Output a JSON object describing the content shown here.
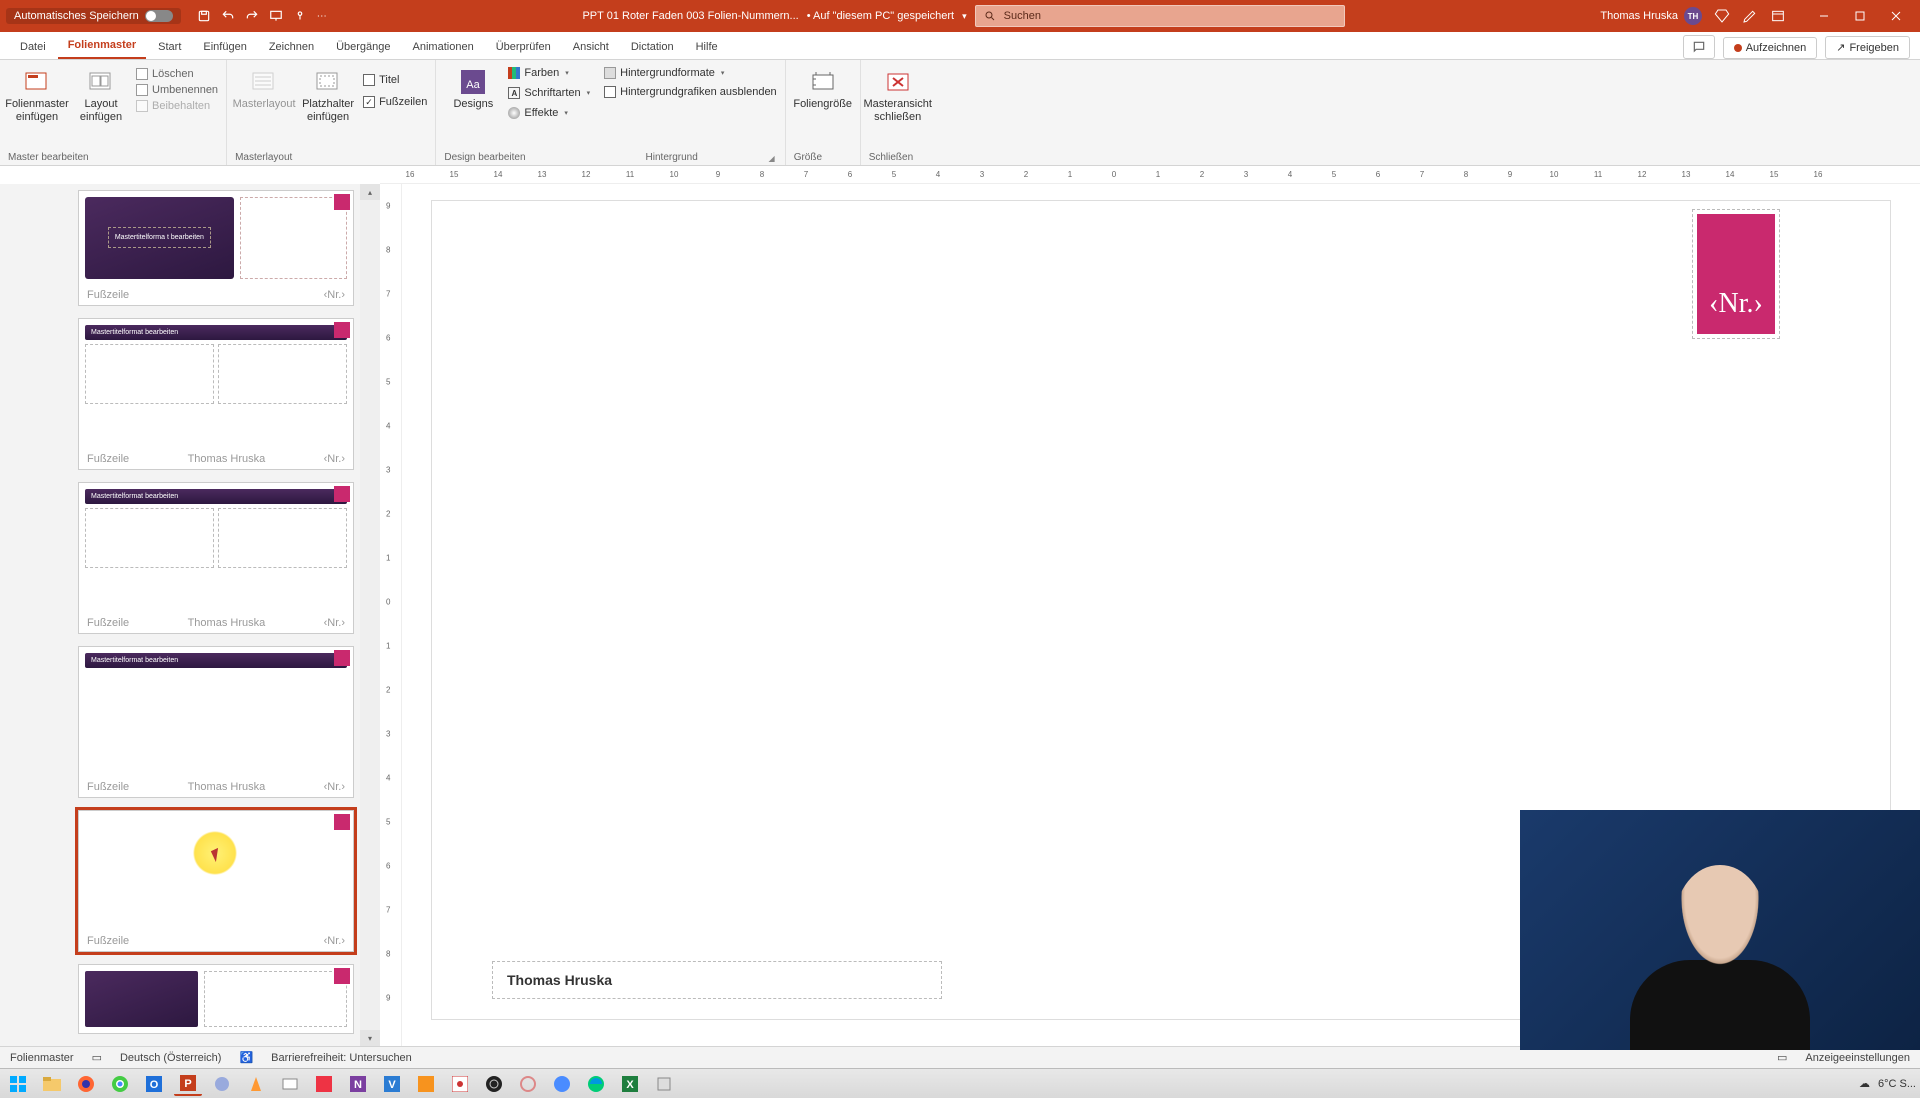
{
  "titlebar": {
    "autosave": "Automatisches Speichern",
    "filename": "PPT 01 Roter Faden 003 Folien-Nummern...",
    "save_loc": "• Auf \"diesem PC\" gespeichert",
    "search_placeholder": "Suchen",
    "user": "Thomas Hruska",
    "user_initials": "TH"
  },
  "tabs": {
    "datei": "Datei",
    "folienmaster": "Folienmaster",
    "start": "Start",
    "einfuegen": "Einfügen",
    "zeichnen": "Zeichnen",
    "uebergaenge": "Übergänge",
    "animationen": "Animationen",
    "ueberpruefen": "Überprüfen",
    "ansicht": "Ansicht",
    "dictation": "Dictation",
    "hilfe": "Hilfe",
    "aufzeichnen": "Aufzeichnen",
    "freigeben": "Freigeben"
  },
  "ribbon": {
    "master_bearbeiten": "Master bearbeiten",
    "folienmaster_einfuegen": "Folienmaster einfügen",
    "layout_einfuegen": "Layout einfügen",
    "loeschen": "Löschen",
    "umbenennen": "Umbenennen",
    "beibehalten": "Beibehalten",
    "masterlayout_group": "Masterlayout",
    "masterlayout_btn": "Masterlayout",
    "platzhalter_einfuegen": "Platzhalter einfügen",
    "titel": "Titel",
    "fusszeilen": "Fußzeilen",
    "designs": "Designs",
    "design_bearbeiten": "Design bearbeiten",
    "farben": "Farben",
    "schriftarten": "Schriftarten",
    "effekte": "Effekte",
    "hintergrund": "Hintergrund",
    "hintergrundformate": "Hintergrundformate",
    "hg_ausblenden": "Hintergrundgrafiken ausblenden",
    "groesse": "Größe",
    "foliengroesse": "Foliengröße",
    "schliessen": "Schließen",
    "masteransicht_schliessen": "Masteransicht schließen"
  },
  "ruler": {
    "h": [
      "16",
      "15",
      "14",
      "13",
      "12",
      "11",
      "10",
      "9",
      "8",
      "7",
      "6",
      "5",
      "4",
      "3",
      "2",
      "1",
      "0",
      "1",
      "2",
      "3",
      "4",
      "5",
      "6",
      "7",
      "8",
      "9",
      "10",
      "11",
      "12",
      "13",
      "14",
      "15",
      "16"
    ],
    "v": [
      "9",
      "8",
      "7",
      "6",
      "5",
      "4",
      "3",
      "2",
      "1",
      "0",
      "1",
      "2",
      "3",
      "4",
      "5",
      "6",
      "7",
      "8",
      "9"
    ]
  },
  "thumbs": {
    "title_text": "Mastertitelformat bearbeiten",
    "title_text_wrap": "Mastertitelforma t bearbeiten",
    "footer_left": "Fußzeile",
    "footer_center": "Thomas Hruska",
    "footer_right": "‹Nr.›"
  },
  "slide": {
    "nr": "‹Nr.›",
    "footer": "Thomas Hruska"
  },
  "status": {
    "mode": "Folienmaster",
    "lang": "Deutsch (Österreich)",
    "accessibility": "Barrierefreiheit: Untersuchen",
    "display": "Anzeigeeinstellungen"
  },
  "taskbar": {
    "weather": "6°C  S..."
  },
  "colors": {
    "accent": "#c43e1c",
    "magenta": "#c9296e",
    "purple": "#3b2355"
  }
}
